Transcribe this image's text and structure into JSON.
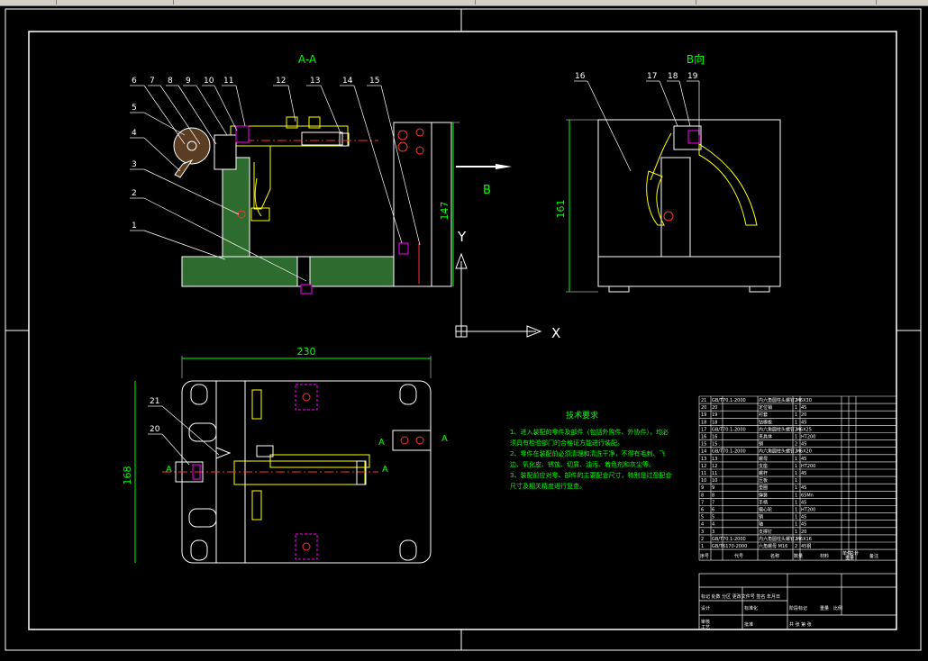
{
  "drawing": {
    "section_label": "A-A",
    "view_label": "B向",
    "arrow_label": "B",
    "axis_y": "Y",
    "axis_x": "X",
    "dim_147": "147",
    "dim_161": "161",
    "dim_230": "230",
    "dim_168": "168",
    "label_A_top": "A",
    "label_A_right_top": "A",
    "label_A_right_bottom": "A",
    "label_A_left": "A",
    "callouts_section": [
      "1",
      "2",
      "3",
      "4",
      "5",
      "6",
      "7",
      "8",
      "9",
      "10",
      "11",
      "12",
      "13",
      "14",
      "15"
    ],
    "callouts_view": [
      "16",
      "17",
      "18",
      "19"
    ],
    "callouts_plan": [
      "20",
      "21"
    ]
  },
  "notes": {
    "title": "技术要求",
    "line1": "1、进入装配的零件及部件（包括外购件、外协件），均必",
    "line2": "须具有检验部门的合格证方能进行装配。",
    "line3": "2、零件在装配前必须清理和清洗干净，不得有毛刺、飞",
    "line4": "边、氧化皮、锈蚀、切屑、油污、着色剂和灰尘等。",
    "line5": "3、装配前应对零、部件的主要配合尺寸，特别是过盈配合",
    "line6": "尺寸及相关精度进行复查。"
  },
  "bom": {
    "header": {
      "seq": "序号",
      "code": "代号",
      "name": "名称",
      "qty": "数量",
      "mat": "材料",
      "unit_wt": "单件",
      "total_wt": "总计",
      "weight_label": "重量",
      "remark": "备注"
    },
    "rows": [
      [
        "21",
        "GB/T70.1-2000",
        "内六角圆柱头螺钉 M6X30",
        "2",
        ""
      ],
      [
        "20",
        "20",
        "定位销",
        "1",
        "45"
      ],
      [
        "19",
        "19",
        "衬套",
        "1",
        "20"
      ],
      [
        "18",
        "18",
        "钻模板",
        "1",
        "45"
      ],
      [
        "17",
        "GB/T70.1-2000",
        "内六角圆柱头螺钉 M6X25",
        "2",
        ""
      ],
      [
        "16",
        "16",
        "夹具体",
        "1",
        "HT200"
      ],
      [
        "15",
        "15",
        "销",
        "2",
        "45"
      ],
      [
        "14",
        "GB/T70.1-2000",
        "内六角圆柱头螺钉 M6X20",
        "2",
        ""
      ],
      [
        "13",
        "13",
        "螺母",
        "1",
        "45"
      ],
      [
        "12",
        "12",
        "支座",
        "1",
        "HT200"
      ],
      [
        "11",
        "11",
        "螺杆",
        "1",
        "45"
      ],
      [
        "10",
        "10",
        "压板",
        "1",
        ""
      ],
      [
        "9",
        "9",
        "垫圈",
        "1",
        "45"
      ],
      [
        "8",
        "8",
        "弹簧",
        "1",
        "65Mn"
      ],
      [
        "7",
        "7",
        "手柄",
        "1",
        "45"
      ],
      [
        "6",
        "6",
        "偏心轮",
        "1",
        "HT200"
      ],
      [
        "5",
        "5",
        "销",
        "1",
        "45"
      ],
      [
        "4",
        "4",
        "轴",
        "1",
        "45"
      ],
      [
        "3",
        "3",
        "支撑钉",
        "1",
        "20"
      ],
      [
        "2",
        "GB/T70.1-2000",
        "内六角圆柱头螺钉 M6X16",
        "2",
        ""
      ],
      [
        "1",
        "GB/T6170-2000",
        "六角螺母 M16",
        "2",
        "45钢"
      ]
    ]
  },
  "title_block": {
    "r1": "标记 处数 分区 更改文件号 签名 年月日",
    "design": "设计",
    "standard": "标准化",
    "stage": "阶段标记",
    "weight": "重量",
    "scale": "比例",
    "review": "审核",
    "process": "工艺",
    "approve": "批准",
    "sheets": "共 张 第 张"
  }
}
